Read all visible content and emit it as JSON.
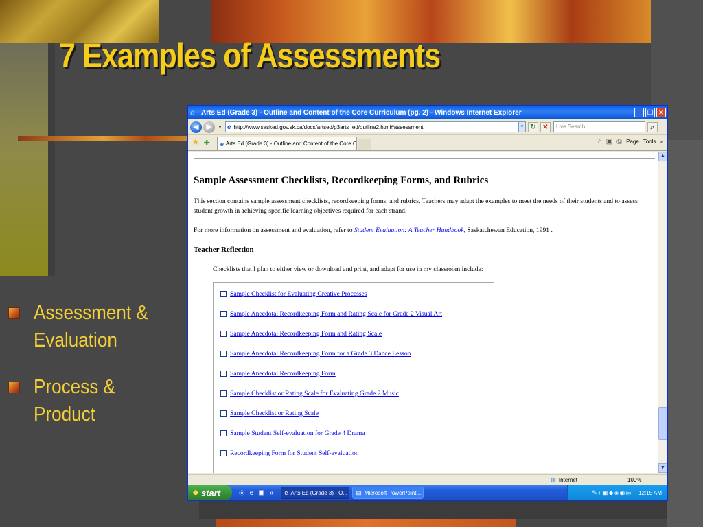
{
  "slide": {
    "title": "7 Examples of Assessments",
    "bullets": [
      {
        "line1": "Assessment &",
        "line2": "Evaluation"
      },
      {
        "line1": "Process &",
        "line2": "Product"
      }
    ]
  },
  "browser": {
    "window_title": "Arts Ed (Grade 3) - Outline and Content of the Core Curriculum (pg. 2) - Windows Internet Explorer",
    "url": "http://www.sasked.gov.sk.ca/docs/artsed/g3arts_ed/outline2.html#assessment",
    "search_placeholder": "Live Search",
    "tab_label": "Arts Ed (Grade 3) - Outline and Content of the Core C...",
    "command_bar": {
      "page_label": "Page",
      "tools_label": "Tools"
    },
    "status": {
      "zone": "Internet",
      "zoom": "100%"
    }
  },
  "page": {
    "heading": "Sample Assessment Checklists, Recordkeeping Forms, and Rubrics",
    "para1": "This section contains sample assessment checklists, recordkeeping forms, and rubrics. Teachers may adapt the examples to meet the needs of their students and to assess student growth in achieving specific learning objectives required for each strand.",
    "para2_prefix": "For more information on assessment and evaluation, refer to ",
    "para2_link": "Student Evaluation: A Teacher Handbook",
    "para2_suffix": ", Saskatchewan Education, 1991 .",
    "subheading": "Teacher Reflection",
    "intro": "Checklists that I plan to either view or download and print, and adapt for use in my classroom include:",
    "checklist": [
      "Sample Checklist for Evaluating Creative Processes",
      "Sample Anecdotal Recordkeeping Form and Rating Scale for Grade 2 Visual Art",
      "Sample Anecdotal Recordkeeping Form and Rating Scale",
      "Sample Anecdotal Recordkeeping Form for a Grade 3 Dance Lesson",
      "Sample Anecdotal Recordkeeping Form",
      "Sample Checklist or Rating Scale for Evaluating Grade 2 Music",
      "Sample Checklist or Rating Scale",
      "Sample Student Self-evaluation for Grade 4 Drama",
      "Recordkeeping Form for Student Self-evaluation"
    ]
  },
  "taskbar": {
    "start_label": "start",
    "tasks": [
      "Arts Ed (Grade 3) - O...",
      "Microsoft PowerPoint ..."
    ],
    "clock": "12:15 AM"
  },
  "icons": {
    "bullet_marker": "square",
    "back": "back-arrow-icon",
    "forward": "forward-arrow-icon",
    "refresh": "refresh-icon",
    "stop": "stop-icon",
    "search": "search-icon",
    "favorites": "star-icon"
  },
  "colors": {
    "title": "#f5cc1a",
    "bullet_text": "#f2cf38",
    "slide_bg": "#474747",
    "ie_titlebar": "#0a5fe8",
    "link": "#0000ee",
    "taskbar": "#245edb",
    "start_button": "#378e37"
  }
}
